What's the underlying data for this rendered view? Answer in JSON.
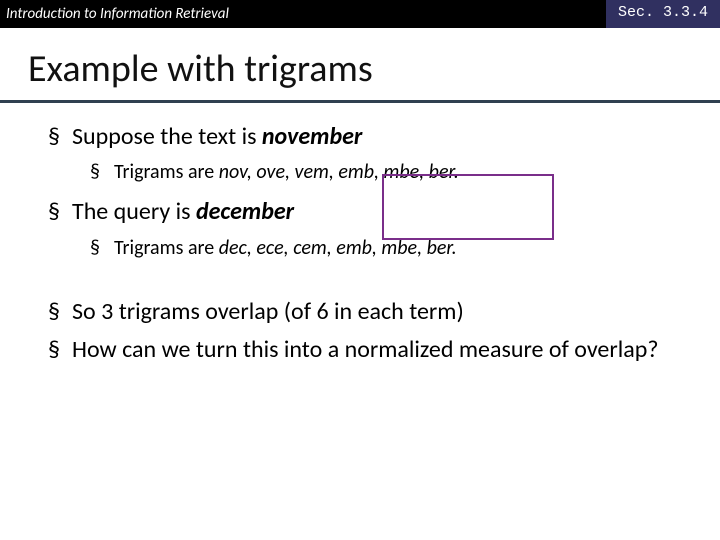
{
  "topbar": {
    "title": "Introduction to Information Retrieval",
    "section": "Sec. 3.3.4"
  },
  "slide": {
    "title": "Example with trigrams"
  },
  "b1": {
    "pre": "Suppose the text is ",
    "word": "november"
  },
  "b1a": {
    "pre": "Trigrams are ",
    "tri": "nov, ove, vem, emb, mbe, ber."
  },
  "b2": {
    "pre": "The query is ",
    "word": "december"
  },
  "b2a": {
    "pre": "Trigrams are ",
    "tri": "dec, ece, cem, emb, mbe, ber."
  },
  "b3": "So 3 trigrams overlap (of 6 in each term)",
  "b4": "How can we turn this into a normalized measure of overlap?"
}
